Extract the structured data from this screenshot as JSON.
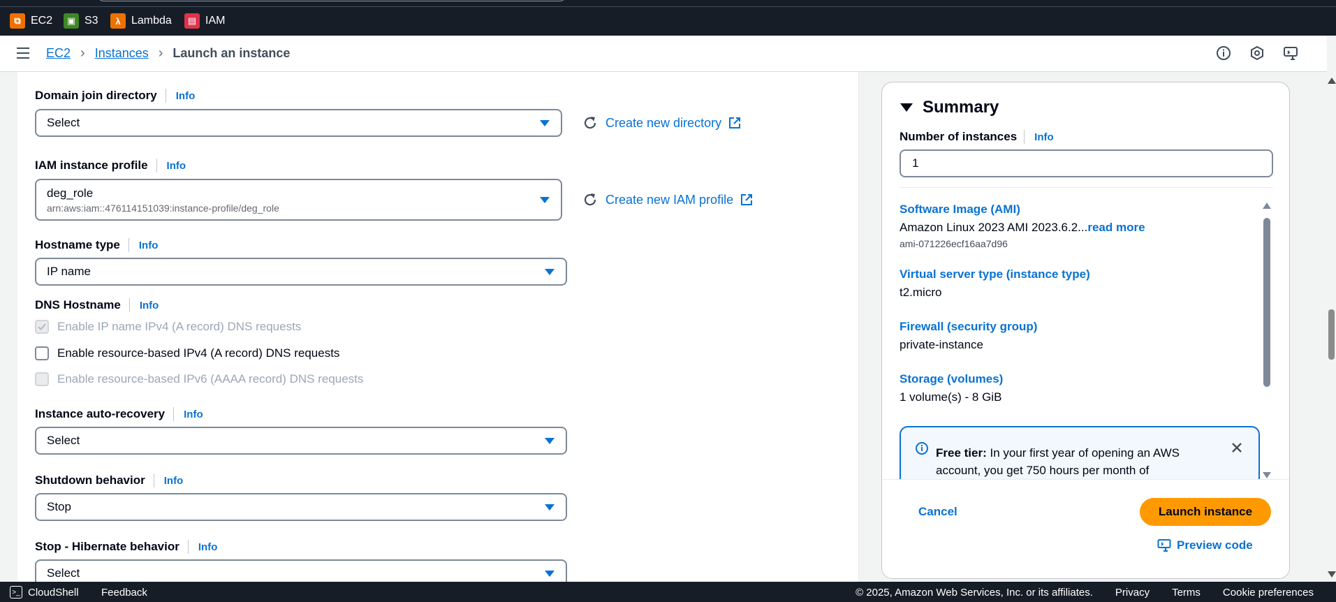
{
  "service_bar": {
    "favorites": [
      {
        "label": "EC2",
        "icon": "ec2-icon",
        "color": "#ed7100"
      },
      {
        "label": "S3",
        "icon": "s3-icon",
        "color": "#3f8624"
      },
      {
        "label": "Lambda",
        "icon": "lambda-icon",
        "color": "#ed7100"
      },
      {
        "label": "IAM",
        "icon": "iam-icon",
        "color": "#dd344c"
      }
    ]
  },
  "breadcrumb": {
    "items": [
      "EC2",
      "Instances"
    ],
    "current": "Launch an instance"
  },
  "form": {
    "domain_join": {
      "label": "Domain join directory",
      "info": "Info",
      "value": "Select",
      "action": "Create new directory"
    },
    "iam_profile": {
      "label": "IAM instance profile",
      "info": "Info",
      "value": "deg_role",
      "sub": "arn:aws:iam::476114151039:instance-profile/deg_role",
      "action": "Create new IAM profile"
    },
    "hostname_type": {
      "label": "Hostname type",
      "info": "Info",
      "value": "IP name"
    },
    "dns_hostname": {
      "label": "DNS Hostname",
      "info": "Info",
      "options": [
        {
          "label": "Enable IP name IPv4 (A record) DNS requests",
          "checked": true,
          "disabled": true
        },
        {
          "label": "Enable resource-based IPv4 (A record) DNS requests",
          "checked": false,
          "disabled": false
        },
        {
          "label": "Enable resource-based IPv6 (AAAA record) DNS requests",
          "checked": false,
          "disabled": true
        }
      ]
    },
    "auto_recovery": {
      "label": "Instance auto-recovery",
      "info": "Info",
      "value": "Select"
    },
    "shutdown": {
      "label": "Shutdown behavior",
      "info": "Info",
      "value": "Stop"
    },
    "hibernate": {
      "label": "Stop - Hibernate behavior",
      "info": "Info",
      "value": "Select"
    }
  },
  "summary": {
    "title": "Summary",
    "num_instances": {
      "label": "Number of instances",
      "info": "Info",
      "value": "1"
    },
    "ami": {
      "title": "Software Image (AMI)",
      "value": "Amazon Linux 2023 AMI 2023.6.2...",
      "read_more": "read more",
      "id": "ami-071226ecf16aa7d96"
    },
    "instance_type": {
      "title": "Virtual server type (instance type)",
      "value": "t2.micro"
    },
    "firewall": {
      "title": "Firewall (security group)",
      "value": "private-instance"
    },
    "storage": {
      "title": "Storage (volumes)",
      "value": "1 volume(s) - 8 GiB"
    },
    "free_tier": {
      "bold": "Free tier:",
      "text": " In your first year of opening an AWS account, you get 750 hours per month of"
    },
    "cancel": "Cancel",
    "launch": "Launch instance",
    "preview": "Preview code"
  },
  "footer": {
    "cloudshell": "CloudShell",
    "feedback": "Feedback",
    "copyright": "© 2025, Amazon Web Services, Inc. or its affiliates.",
    "links": [
      "Privacy",
      "Terms",
      "Cookie preferences"
    ]
  }
}
